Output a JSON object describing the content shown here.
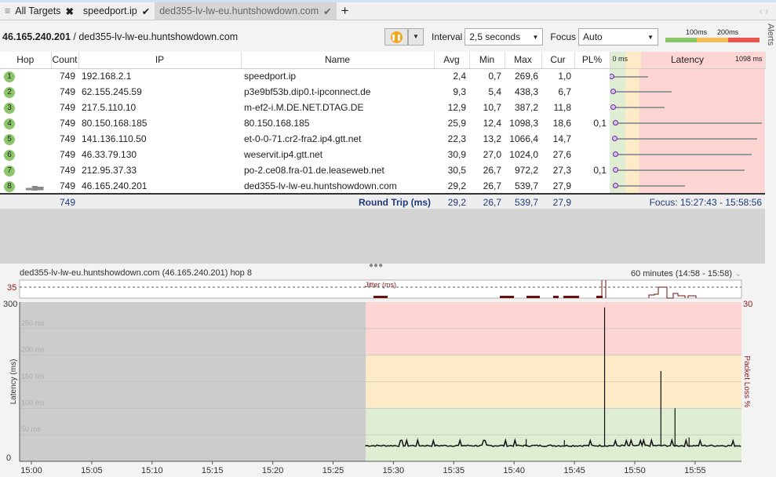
{
  "tabs": {
    "all": "All Targets",
    "t1": "speedport.ip",
    "t2": "ded355-lv-lw-eu.huntshowdown.com",
    "add": "+"
  },
  "address": {
    "ip": "46.165.240.201",
    "sep": " / ",
    "host": "ded355-lv-lw-eu.huntshowdown.com"
  },
  "toolbar": {
    "interval_label": "Interval",
    "interval_value": "2,5 seconds",
    "focus_label": "Focus",
    "focus_value": "Auto",
    "scale_100": "100ms",
    "scale_200": "200ms",
    "alerts": "Alerts"
  },
  "columns": [
    "Hop",
    "Count",
    "IP",
    "Name",
    "Avg",
    "Min",
    "Max",
    "Cur",
    "PL%"
  ],
  "latency_header": {
    "min": "0 ms",
    "title": "Latency",
    "max": "1098 ms"
  },
  "hops": [
    {
      "hop": "1",
      "count": "749",
      "ip": "192.168.2.1",
      "name": "speedport.ip",
      "avg": "2,4",
      "min": "0,7",
      "max": "269,6",
      "cur": "1,0",
      "pl": ""
    },
    {
      "hop": "2",
      "count": "749",
      "ip": "62.155.245.59",
      "name": "p3e9bf53b.dip0.t-ipconnect.de",
      "avg": "9,3",
      "min": "5,4",
      "max": "438,3",
      "cur": "6,7",
      "pl": ""
    },
    {
      "hop": "3",
      "count": "749",
      "ip": "217.5.110.10",
      "name": "m-ef2-i.M.DE.NET.DTAG.DE",
      "avg": "12,9",
      "min": "10,7",
      "max": "387,2",
      "cur": "11,8",
      "pl": ""
    },
    {
      "hop": "4",
      "count": "749",
      "ip": "80.150.168.185",
      "name": "80.150.168.185",
      "avg": "25,9",
      "min": "12,4",
      "max": "1098,3",
      "cur": "18,6",
      "pl": "0,1"
    },
    {
      "hop": "5",
      "count": "749",
      "ip": "141.136.110.50",
      "name": "et-0-0-71.cr2-fra2.ip4.gtt.net",
      "avg": "22,3",
      "min": "13,2",
      "max": "1066,4",
      "cur": "14,7",
      "pl": ""
    },
    {
      "hop": "6",
      "count": "749",
      "ip": "46.33.79.130",
      "name": "weservit.ip4.gtt.net",
      "avg": "30,9",
      "min": "27,0",
      "max": "1024,0",
      "cur": "27,6",
      "pl": ""
    },
    {
      "hop": "7",
      "count": "749",
      "ip": "212.95.37.33",
      "name": "po-2.ce08.fra-01.de.leaseweb.net",
      "avg": "30,5",
      "min": "26,7",
      "max": "972,2",
      "cur": "27,3",
      "pl": "0,1"
    },
    {
      "hop": "8",
      "count": "749",
      "ip": "46.165.240.201",
      "name": "ded355-lv-lw-eu.huntshowdown.com",
      "avg": "29,2",
      "min": "26,7",
      "max": "539,7",
      "cur": "27,9",
      "pl": ""
    }
  ],
  "round_trip": {
    "count": "749",
    "label": "Round Trip (ms)",
    "avg": "29,2",
    "min": "26,7",
    "max": "539,7",
    "cur": "27,9",
    "focus": "Focus: 15:27:43 - 15:58:56"
  },
  "graph": {
    "title": "ded355-lv-lw-eu.huntshowdown.com (46.165.240.201) hop 8",
    "range": "60 minutes (14:58 - 15:58)",
    "jitter_label": "Jitter (ms)",
    "jitter_ref": "35",
    "y_left_top": "300",
    "y_left_bottom": "0",
    "y_right_top": "30",
    "ylabel": "Latency (ms)",
    "y2label": "Packet Loss %",
    "gridlabels": [
      "250 ms",
      "200 ms",
      "150 ms",
      "100 ms",
      "50 ms"
    ]
  },
  "chart_data": {
    "type": "line",
    "ylim": [
      0,
      300
    ],
    "xticks": [
      "15:00",
      "15:05",
      "15:10",
      "15:15",
      "15:20",
      "15:25",
      "15:30",
      "15:35",
      "15:40",
      "15:45",
      "15:50",
      "15:55"
    ],
    "data_start": "15:27:43",
    "baseline_ms": 28,
    "spikes": [
      {
        "t": "15:47:30",
        "ms": 290
      },
      {
        "t": "15:52:10",
        "ms": 170
      },
      {
        "t": "15:53:20",
        "ms": 100
      },
      {
        "t": "15:54:30",
        "ms": 45
      },
      {
        "t": "15:41:00",
        "ms": 42
      },
      {
        "t": "15:44:10",
        "ms": 40
      }
    ],
    "bands": {
      "green": "#dfeed3",
      "yellow": "#fdebc8",
      "red": "#fdd5d3",
      "gray": "#cccccc"
    }
  }
}
